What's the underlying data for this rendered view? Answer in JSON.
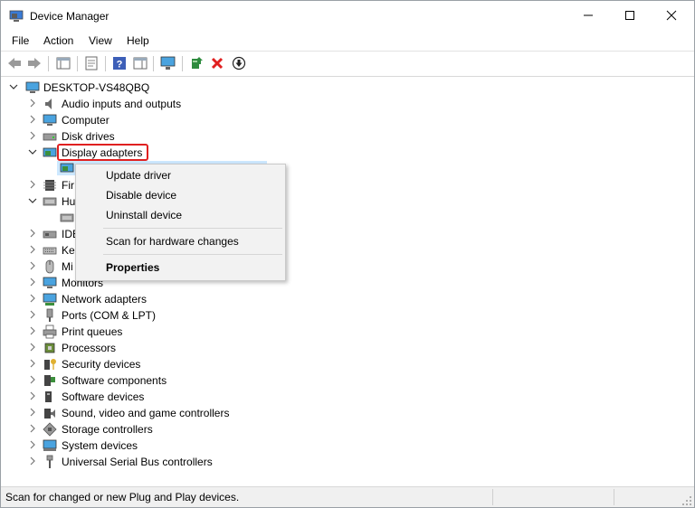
{
  "window": {
    "title": "Device Manager"
  },
  "menu": [
    "File",
    "Action",
    "View",
    "Help"
  ],
  "tree": {
    "root": "DESKTOP-VS48QBQ",
    "items": [
      "Audio inputs and outputs",
      "Computer",
      "Disk drives",
      "Display adapters",
      "Fir",
      "Hu",
      "IDE",
      "Ke",
      "Mi",
      "Monitors",
      "Network adapters",
      "Ports (COM & LPT)",
      "Print queues",
      "Processors",
      "Security devices",
      "Software components",
      "Software devices",
      "Sound, video and game controllers",
      "Storage controllers",
      "System devices",
      "Universal Serial Bus controllers"
    ]
  },
  "context_menu": {
    "update": "Update driver",
    "disable": "Disable device",
    "uninstall": "Uninstall device",
    "scan": "Scan for hardware changes",
    "properties": "Properties"
  },
  "status": {
    "text": "Scan for changed or new Plug and Play devices."
  },
  "colors": {
    "highlight_box": "#e02020",
    "selection": "#cde8ff",
    "uninstall_x": "#e02020"
  }
}
